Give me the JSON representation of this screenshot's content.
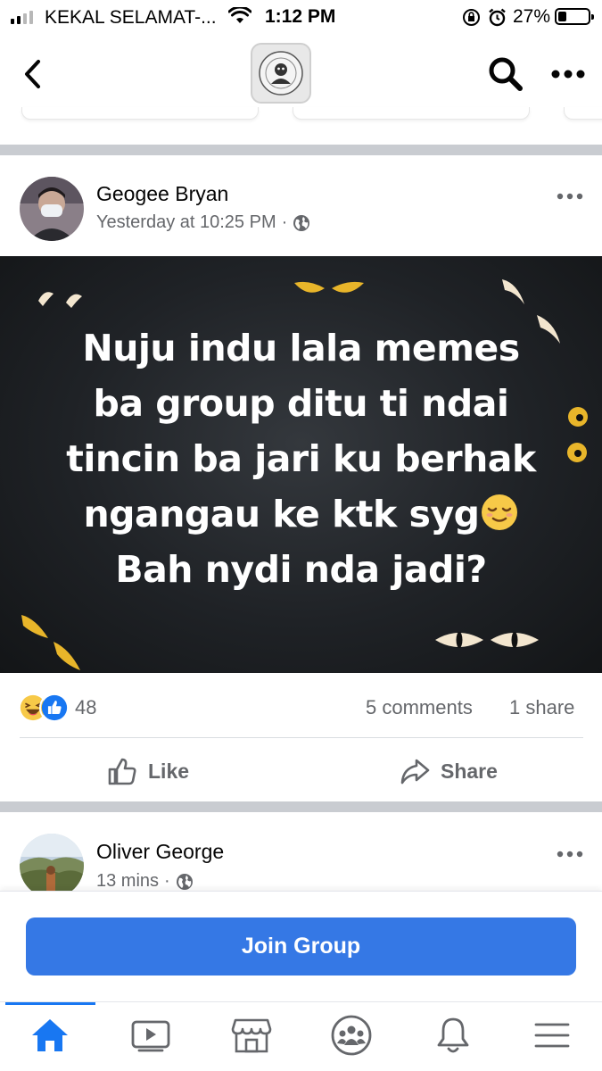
{
  "status_bar": {
    "carrier": "KEKAL SELAMAT-...",
    "time": "1:12 PM",
    "battery_percent": "27%",
    "battery_level": 0.27,
    "signal_bars": 2
  },
  "header": {
    "icons": [
      "back-chevron-icon",
      "group-logo",
      "search-icon",
      "more-icon"
    ]
  },
  "post": {
    "author": "Geogee Bryan",
    "timestamp": "Yesterday at 10:25 PM",
    "separator": "·",
    "privacy_icon": "globe-icon",
    "meme_lines": [
      "Nuju indu lala memes",
      "ba group ditu ti ndai",
      "tincin ba jari ku berhak",
      "ngangau ke ktk syg",
      "Bah nydi nda jadi?"
    ],
    "meme_emoji": "relieved-face-emoji",
    "reaction_count": "48",
    "reaction_icons": [
      "haha-reaction-icon",
      "like-reaction-icon"
    ],
    "comments": "5 comments",
    "shares": "1 share",
    "like_label": "Like",
    "share_label": "Share"
  },
  "next_post": {
    "author": "Oliver George",
    "timestamp": "13 mins",
    "separator": "·"
  },
  "join_group": {
    "label": "Join Group"
  },
  "tabbar": {
    "tabs": [
      "home-icon",
      "video-icon",
      "marketplace-icon",
      "groups-icon",
      "notifications-icon",
      "menu-icon"
    ],
    "active": "home-icon"
  },
  "colors": {
    "accent": "#3578e5",
    "active_tab": "#1877f2",
    "meta_text": "#65676b",
    "divider": "#c9ccd1"
  }
}
